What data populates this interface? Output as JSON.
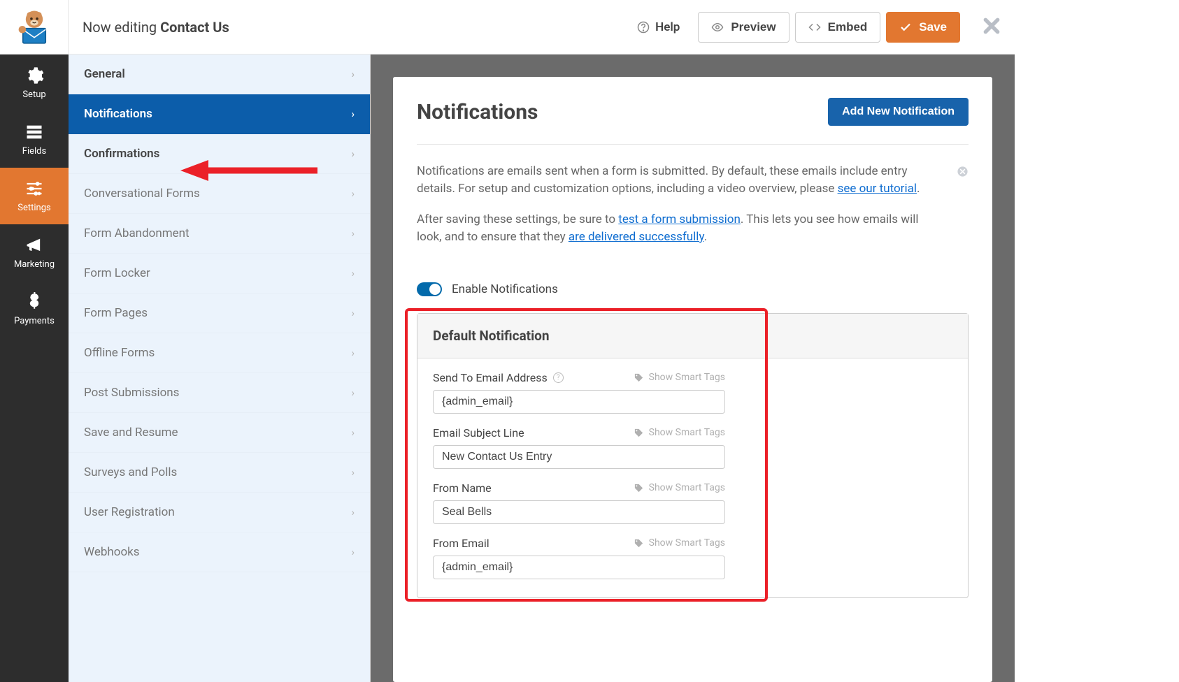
{
  "header": {
    "editing_prefix": "Now editing ",
    "form_name": "Contact Us",
    "help": "Help",
    "preview": "Preview",
    "embed": "Embed",
    "save": "Save"
  },
  "leftnav": {
    "items": [
      {
        "id": "setup",
        "label": "Setup"
      },
      {
        "id": "fields",
        "label": "Fields"
      },
      {
        "id": "settings",
        "label": "Settings"
      },
      {
        "id": "marketing",
        "label": "Marketing"
      },
      {
        "id": "payments",
        "label": "Payments"
      }
    ]
  },
  "subnav": {
    "items": [
      {
        "label": "General",
        "bold": true
      },
      {
        "label": "Notifications",
        "bold": true,
        "active": true
      },
      {
        "label": "Confirmations",
        "bold": true
      },
      {
        "label": "Conversational Forms"
      },
      {
        "label": "Form Abandonment"
      },
      {
        "label": "Form Locker"
      },
      {
        "label": "Form Pages"
      },
      {
        "label": "Offline Forms"
      },
      {
        "label": "Post Submissions"
      },
      {
        "label": "Save and Resume"
      },
      {
        "label": "Surveys and Polls"
      },
      {
        "label": "User Registration"
      },
      {
        "label": "Webhooks"
      }
    ]
  },
  "panel": {
    "title": "Notifications",
    "add_btn": "Add New Notification",
    "desc_p1a": "Notifications are emails sent when a form is submitted. By default, these emails include entry details. For setup and customization options, including a video overview, please ",
    "desc_p1_link": "see our tutorial",
    "desc_p1b": ".",
    "desc_p2a": "After saving these settings, be sure to ",
    "desc_p2_link1": "test a form submission",
    "desc_p2b": ". This lets you see how emails will look, and to ensure that they ",
    "desc_p2_link2": "are delivered successfully",
    "desc_p2c": ".",
    "toggle_label": "Enable Notifications",
    "notif_title": "Default Notification",
    "smart_tags": "Show Smart Tags",
    "fields": [
      {
        "label": "Send To Email Address",
        "value": "{admin_email}",
        "help": true
      },
      {
        "label": "Email Subject Line",
        "value": "New Contact Us Entry"
      },
      {
        "label": "From Name",
        "value": "Seal Bells"
      },
      {
        "label": "From Email",
        "value": "{admin_email}"
      }
    ]
  }
}
